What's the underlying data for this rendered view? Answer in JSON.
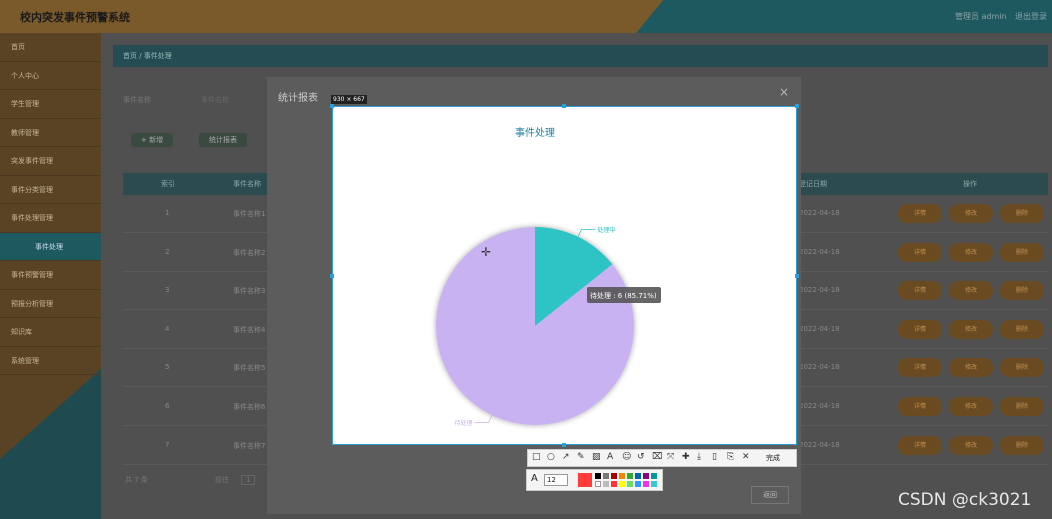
{
  "app": {
    "title": "校内突发事件预警系统",
    "header_right": [
      "管理员 admin",
      "退出登录"
    ]
  },
  "sidebar": {
    "items": [
      "首页",
      "个人中心",
      "学生管理",
      "教师管理",
      "突发事件管理",
      "事件分类管理",
      "事件处理管理",
      "事件处理",
      "事件预警管理",
      "预报分析管理",
      "知识库",
      "系统管理"
    ]
  },
  "breadcrumb": "首页 / 事件处理",
  "search": {
    "label": "事件名称",
    "placeholder": "事件名称"
  },
  "buttons": {
    "add": "+ 新增",
    "report": "统计报表"
  },
  "table": {
    "headers": [
      "索引",
      "事件名称",
      "登记日期",
      "操作"
    ],
    "rows": [
      {
        "idx": "1",
        "name": "事件名称1",
        "date": "2022-04-18"
      },
      {
        "idx": "2",
        "name": "事件名称2",
        "date": "2022-04-18"
      },
      {
        "idx": "3",
        "name": "事件名称3",
        "date": "2022-04-18"
      },
      {
        "idx": "4",
        "name": "事件名称4",
        "date": "2022-04-18"
      },
      {
        "idx": "5",
        "name": "事件名称5",
        "date": "2022-04-18"
      },
      {
        "idx": "6",
        "name": "事件名称6",
        "date": "2022-04-18"
      },
      {
        "idx": "7",
        "name": "事件名称7",
        "date": "2022-04-18"
      }
    ],
    "row_actions": [
      "详情",
      "修改",
      "删除"
    ]
  },
  "pagination": {
    "total": "共 7 条",
    "goto": "前往",
    "page": "1"
  },
  "modal": {
    "title": "统计报表",
    "close": "×",
    "button": "返回"
  },
  "screenshot_tool": {
    "size_badge": "930 × 667",
    "tools": [
      "□",
      "○",
      "↗",
      "✎",
      "▨",
      "A",
      "☺",
      "↺",
      "⌧",
      "⤧",
      "✚",
      "⤓",
      "▯",
      "⎘",
      "✕"
    ],
    "done": "完成",
    "font_size": "12",
    "active_color": "#ff3b3b"
  },
  "chart_data": {
    "type": "pie",
    "title": "事件处理",
    "slices": [
      {
        "name": "待处理",
        "value": 6,
        "color": "#c8b2f2"
      },
      {
        "name": "处理中",
        "value": 1,
        "color": "#2ec4c6"
      }
    ],
    "tooltip": "待处理 : 6 (85.71%)"
  },
  "watermark": "CSDN @ck3021"
}
